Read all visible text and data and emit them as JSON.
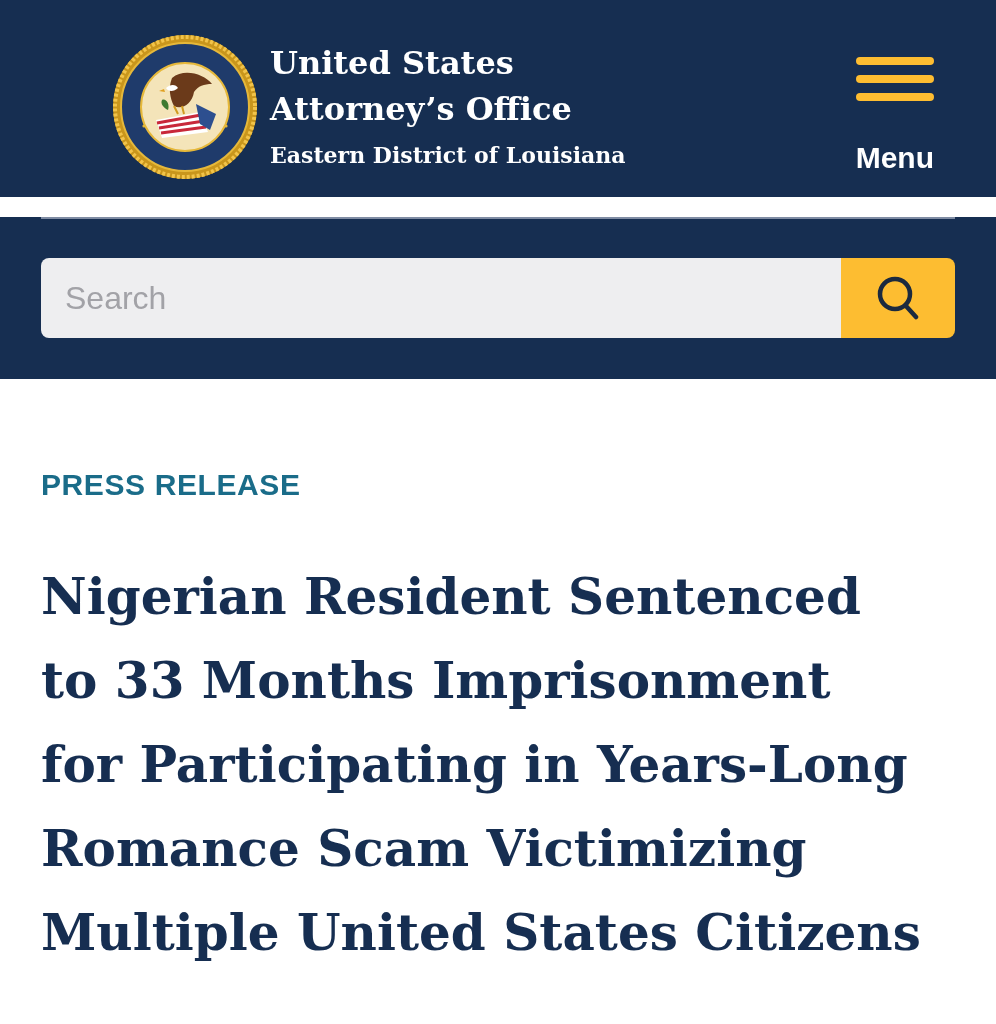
{
  "header": {
    "title_lines": [
      "United States",
      "Attorney’s Office"
    ],
    "district": "Eastern District of Louisiana",
    "menu_label": "Menu"
  },
  "search": {
    "placeholder": "Search"
  },
  "article": {
    "category": "PRESS RELEASE",
    "title": "Nigerian Resident Sentenced to 33 Months Imprisonment for Participating in Years-Long Romance Scam Victimizing Multiple United States Citizens"
  }
}
